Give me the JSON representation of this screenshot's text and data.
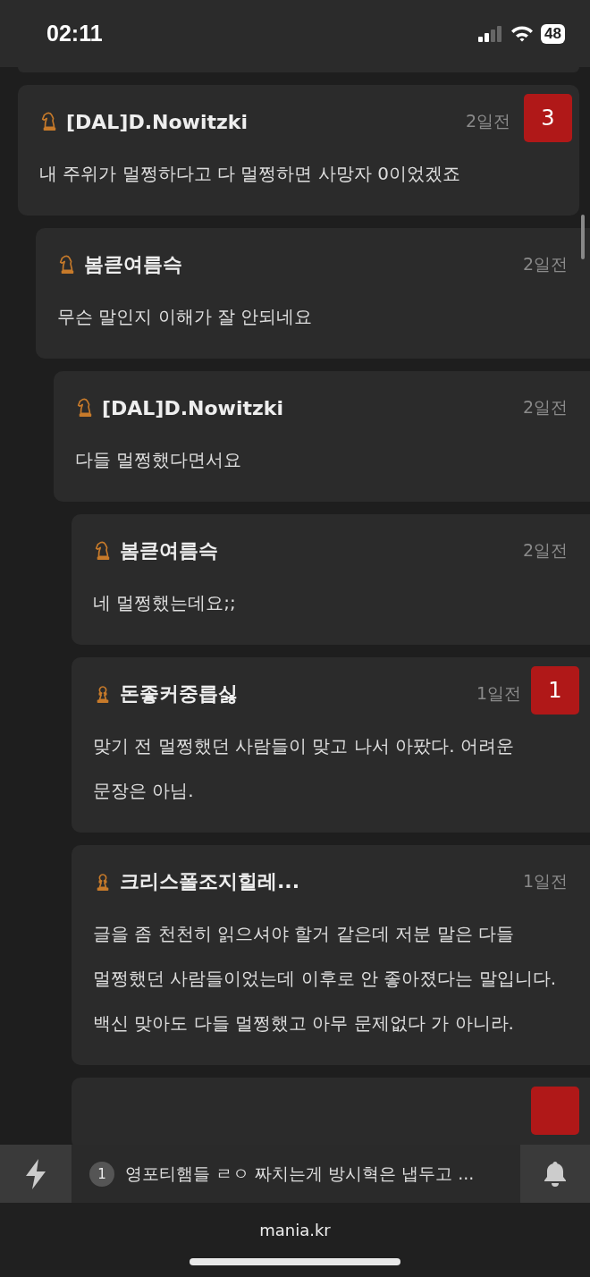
{
  "status_bar": {
    "time": "02:11",
    "battery": "48"
  },
  "comments": [
    {
      "author": "[DAL]D.Nowitzki",
      "kind": "knight",
      "time": "2일전",
      "votes": "3",
      "text": "내 주위가 멀쩡하다고 다 멀쩡하면 사망자 0이었겠죠",
      "children": [
        {
          "author": "봄큳여름슥",
          "kind": "knight",
          "time": "2일전",
          "text": "무슨 말인지 이해가 잘 안되네요",
          "children": [
            {
              "author": "[DAL]D.Nowitzki",
              "kind": "knight",
              "time": "2일전",
              "text": "다들 멀쩡했다면서요",
              "children": [
                {
                  "author": "봄큳여름슥",
                  "kind": "knight",
                  "time": "2일전",
                  "text": "네 멀쩡했는데요;;"
                },
                {
                  "author": "돈좋커중릅싫",
                  "kind": "pawn",
                  "time": "1일전",
                  "votes": "1",
                  "text": "맞기 전 멀쩡했던 사람들이 맞고 나서 아팠다. 어려운 문장은 아님."
                },
                {
                  "author": "크리스폴조지힐레...",
                  "kind": "pawn",
                  "time": "1일전",
                  "text": "글을 좀 천천히 읽으셔야 할거 같은데 저분 말은 다들 멀쩡했던 사람들이었는데 이후로 안 좋아졌다는 말입니다.\n백신 맞아도 다들 멀쩡했고 아무 문제없다 가 아니라."
                },
                {
                  "kind": "cut-off",
                  "voted": true
                }
              ]
            }
          ]
        }
      ]
    }
  ],
  "ticker": {
    "count": "1",
    "text": "영포티햄들 ㄹㅇ 짜치는게 방시혁은 냅두고 ..."
  },
  "footer": {
    "domain": "mania.kr"
  }
}
